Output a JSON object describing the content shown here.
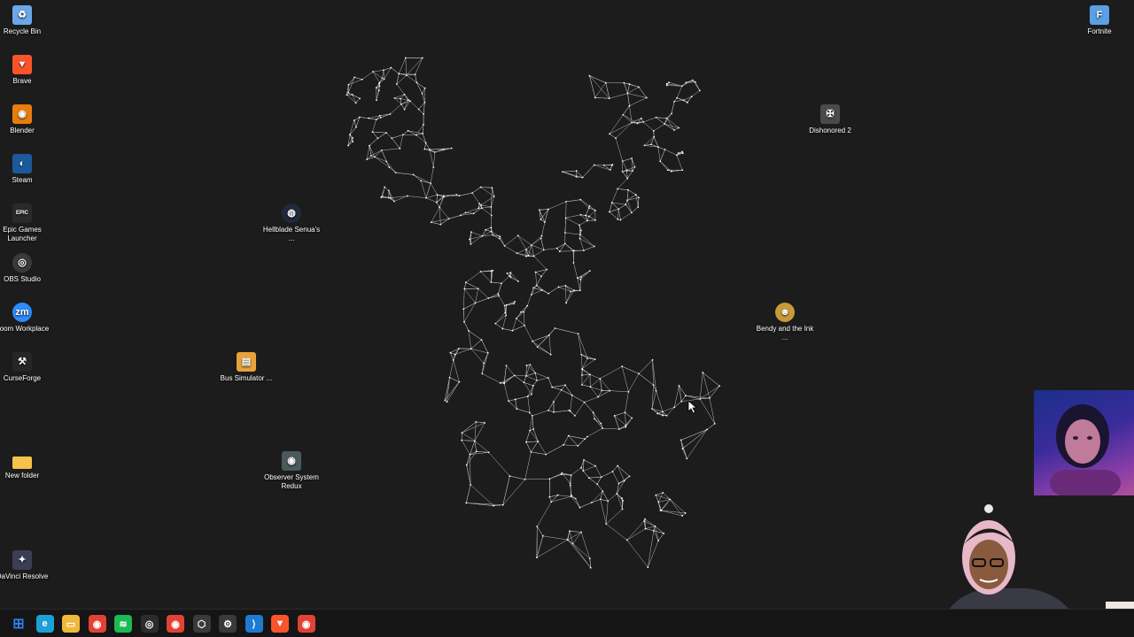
{
  "desktop": {
    "icons_left": [
      {
        "label": "Recycle Bin",
        "icon": "recycle-bin-icon",
        "color": "#6aa8e8",
        "glyph": "♻"
      },
      {
        "label": "Brave",
        "icon": "brave-icon",
        "color": "#fb542b",
        "glyph": "▼"
      },
      {
        "label": "Blender",
        "icon": "blender-icon",
        "color": "#e87d0d",
        "glyph": "◉"
      },
      {
        "label": "Steam",
        "icon": "steam-icon",
        "color": "#1b5a9a",
        "glyph": "◐"
      },
      {
        "label": "Epic Games Launcher",
        "icon": "epic-games-icon",
        "color": "#2a2a2a",
        "glyph": "EPIC"
      },
      {
        "label": "OBS Studio",
        "icon": "obs-icon",
        "color": "#3a3a3a",
        "glyph": "◎"
      },
      {
        "label": "Zoom Workplace",
        "icon": "zoom-icon",
        "color": "#2d8cff",
        "glyph": "zm"
      },
      {
        "label": "CurseForge",
        "icon": "curseforge-icon",
        "color": "#262626",
        "glyph": "⚒"
      },
      {
        "label": "New folder",
        "icon": "folder-icon",
        "color": "#f5c24b",
        "glyph": ""
      },
      {
        "label": "DaVinci Resolve",
        "icon": "davinci-icon",
        "color": "#3a3f55",
        "glyph": "✦"
      }
    ],
    "icons_other": [
      {
        "label": "Hellblade Senua's ...",
        "icon": "hellblade-icon",
        "color": "#1f2b3a",
        "glyph": "◍"
      },
      {
        "label": "Bus Simulator ...",
        "icon": "bus-simulator-icon",
        "color": "#e8a23a",
        "glyph": "▤"
      },
      {
        "label": "Observer System Redux",
        "icon": "observer-icon",
        "color": "#4a5a5a",
        "glyph": "◉"
      },
      {
        "label": "Dishonored 2",
        "icon": "dishonored-icon",
        "color": "#4a4a4a",
        "glyph": "✠"
      },
      {
        "label": "Bendy and the Ink ...",
        "icon": "bendy-icon",
        "color": "#c79a3a",
        "glyph": "☻"
      },
      {
        "label": "Fortnite",
        "icon": "fortnite-icon",
        "color": "#5aa0e6",
        "glyph": "F"
      }
    ]
  },
  "taskbar": {
    "apps": [
      {
        "icon": "start-icon",
        "color": "#2b7de9",
        "glyph": "⊞"
      },
      {
        "icon": "edge-icon",
        "color": "#1f9fd8",
        "glyph": "e"
      },
      {
        "icon": "file-explorer-icon",
        "color": "#f0b83a",
        "glyph": "▭"
      },
      {
        "icon": "chrome-icon",
        "color": "#e24236",
        "glyph": "◉"
      },
      {
        "icon": "spotify-icon",
        "color": "#1db954",
        "glyph": "≋"
      },
      {
        "icon": "obs-icon",
        "color": "#2c2c2c",
        "glyph": "◎"
      },
      {
        "icon": "chrome-profile-icon",
        "color": "#e24236",
        "glyph": "◉"
      },
      {
        "icon": "settings-app-icon",
        "color": "#3a3a3a",
        "glyph": "⬡"
      },
      {
        "icon": "gear-icon",
        "color": "#3a3a3a",
        "glyph": "⚙"
      },
      {
        "icon": "vscode-icon",
        "color": "#1f7bd1",
        "glyph": "⟩"
      },
      {
        "icon": "brave-icon",
        "color": "#fb542b",
        "glyph": "▼"
      },
      {
        "icon": "chrome-canary-icon",
        "color": "#e24236",
        "glyph": "◉"
      }
    ]
  }
}
